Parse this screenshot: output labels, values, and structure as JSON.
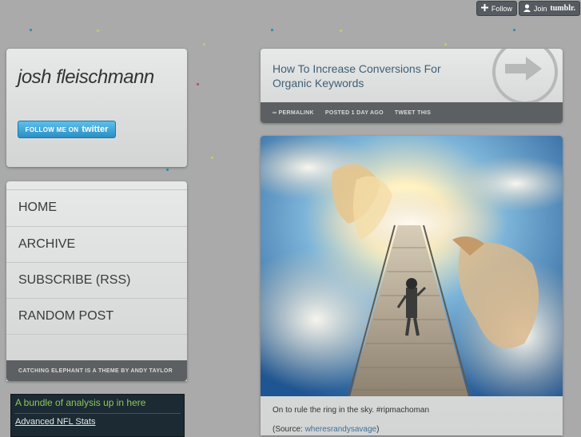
{
  "tumblr": {
    "follow_label": "Follow",
    "join_label": "Join",
    "join_brand": "tumblr."
  },
  "sidebar": {
    "blog_title": "josh fleischmann",
    "twitter_label": "FOLLOW ME ON",
    "twitter_brand": "twitter",
    "nav": [
      {
        "label": "HOME"
      },
      {
        "label": "ARCHIVE"
      },
      {
        "label": "SUBSCRIBE (RSS)"
      },
      {
        "label": "RANDOM POST"
      }
    ],
    "theme_credit": "CATCHING ELEPHANT IS A THEME BY ANDY TAYLOR",
    "widget": {
      "title": "A bundle of analysis up in here",
      "link": "Advanced NFL Stats"
    }
  },
  "post": {
    "title": "How To Increase Conversions For Organic Keywords",
    "meta": {
      "permalink": "∞ PERMALINK",
      "posted": "POSTED 1 DAY AGO",
      "tweet": "TWEET THIS"
    }
  },
  "photo_post": {
    "caption": "On to rule the ring in the sky. #ripmachoman",
    "source_prefix": "(Source: ",
    "source_link": "wheresrandysavage",
    "source_suffix": ")"
  },
  "colors": {
    "background": "#a9aaa9",
    "card": "#dfe0e0",
    "meta_bar": "#5d6062",
    "title_link": "#3f5f75",
    "twitter": "#2a8fc4",
    "widget_bg": "#1b2a33",
    "widget_title": "#8fc75c"
  }
}
